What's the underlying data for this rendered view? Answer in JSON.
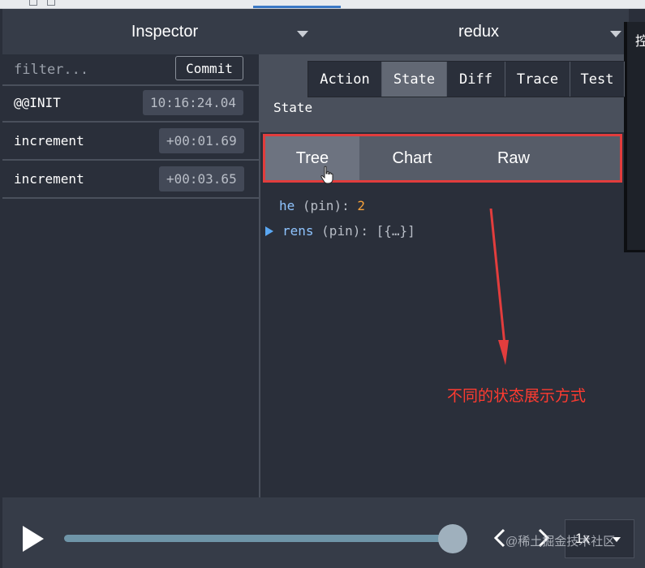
{
  "header": {
    "left_title": "Inspector",
    "right_title": "redux",
    "edge_glyph": "控"
  },
  "left": {
    "filter_placeholder": "filter...",
    "commit_label": "Commit",
    "actions": [
      {
        "name": "@@INIT",
        "time": "10:16:24.04"
      },
      {
        "name": "increment",
        "time": "+00:01.69"
      },
      {
        "name": "increment",
        "time": "+00:03.65"
      }
    ]
  },
  "right": {
    "tabs": [
      {
        "label": "Action"
      },
      {
        "label": "State"
      },
      {
        "label": "Diff"
      },
      {
        "label": "Trace"
      },
      {
        "label": "Test"
      }
    ],
    "active_tab": "State",
    "section_label": "State",
    "subtabs": [
      {
        "label": "Tree"
      },
      {
        "label": "Chart"
      },
      {
        "label": "Raw"
      }
    ],
    "active_subtab": "Tree",
    "tree": [
      {
        "key": "he",
        "tag": "(pin):",
        "value": "2"
      },
      {
        "key": "rens",
        "tag": "(pin):",
        "value": "[{…}]"
      }
    ],
    "annotation": "不同的状态展示方式"
  },
  "bottom": {
    "speed": "1x",
    "watermark": "@稀土掘金技术社区"
  },
  "colors": {
    "annotation_red": "#e23d3d",
    "tree_key": "#8fc4ff",
    "tree_number": "#f6a13a"
  }
}
